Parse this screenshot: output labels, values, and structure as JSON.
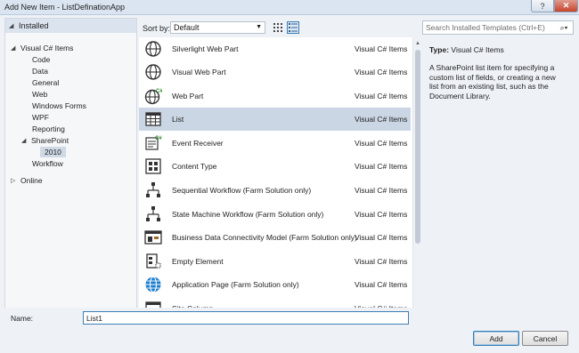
{
  "window": {
    "title": "Add New Item - ListDefinationApp",
    "help_label": "?",
    "close_label": "✕"
  },
  "tree": {
    "installed": "Installed",
    "root": "Visual C# Items",
    "items": [
      "Code",
      "Data",
      "General",
      "Web",
      "Windows Forms",
      "WPF",
      "Reporting"
    ],
    "sharepoint": "SharePoint",
    "sharepoint_child": "2010",
    "workflow": "Workflow",
    "online": "Online"
  },
  "sort": {
    "label": "Sort by:",
    "value": "Default"
  },
  "templates": [
    {
      "name": "Silverlight Web Part",
      "category": "Visual C# Items",
      "icon": "globe-icon"
    },
    {
      "name": "Visual Web Part",
      "category": "Visual C# Items",
      "icon": "globe-icon"
    },
    {
      "name": "Web Part",
      "category": "Visual C# Items",
      "icon": "globe-csharp-icon"
    },
    {
      "name": "List",
      "category": "Visual C# Items",
      "icon": "list-icon",
      "selected": true
    },
    {
      "name": "Event Receiver",
      "category": "Visual C# Items",
      "icon": "event-receiver-icon"
    },
    {
      "name": "Content Type",
      "category": "Visual C# Items",
      "icon": "content-type-icon"
    },
    {
      "name": "Sequential Workflow (Farm Solution only)",
      "category": "Visual C# Items",
      "icon": "workflow-icon"
    },
    {
      "name": "State Machine Workflow (Farm Solution only)",
      "category": "Visual C# Items",
      "icon": "workflow-icon"
    },
    {
      "name": "Business Data Connectivity Model (Farm Solution only)",
      "category": "Visual C# Items",
      "icon": "bdc-model-icon"
    },
    {
      "name": "Empty Element",
      "category": "Visual C# Items",
      "icon": "empty-element-icon"
    },
    {
      "name": "Application Page (Farm Solution only)",
      "category": "Visual C# Items",
      "icon": "globe-blue-icon"
    },
    {
      "name": "Site Column",
      "category": "Visual C# Items",
      "icon": "site-column-icon"
    }
  ],
  "search": {
    "placeholder": "Search Installed Templates (Ctrl+E)"
  },
  "details": {
    "type_label": "Type:",
    "type_value": "Visual C# Items",
    "description": "A SharePoint list item for specifying a custom list of fields, or creating a new list from an existing list, such as the Document Library."
  },
  "name_field": {
    "label": "Name:",
    "value": "List1"
  },
  "buttons": {
    "add": "Add",
    "cancel": "Cancel"
  }
}
